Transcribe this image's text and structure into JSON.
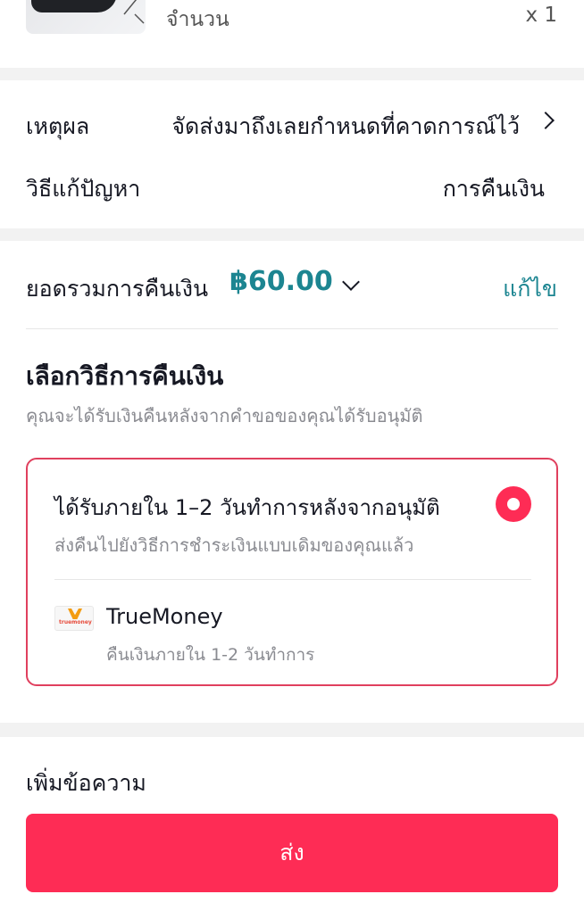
{
  "product": {
    "quantity_label": "จำนวน",
    "quantity_value": "x 1"
  },
  "reason": {
    "label": "เหตุผล",
    "value": "จัดส่งมาถึงเลยกำหนดที่คาดการณ์ไว้",
    "solution_label": "วิธีแก้ปัญหา",
    "solution_value": "การคืนเงิน"
  },
  "refund": {
    "total_label": "ยอดรวมการคืนเงิน",
    "total_amount": "฿60.00",
    "edit_label": "แก้ไข",
    "method_title": "เลือกวิธีการคืนเงิน",
    "method_subtitle": "คุณจะได้รับเงินคืนหลังจากคำขอของคุณได้รับอนุมัติ",
    "option": {
      "title": "ได้รับภายใน 1–2 วันทำการหลังจากอนุมัติ",
      "subtitle": "ส่งคืนไปยังวิธีการชำระเงินแบบเดิมของคุณแล้ว",
      "selected": true,
      "wallet_name": "TrueMoney",
      "wallet_subtitle": "คืนเงินภายใน 1-2 วันทำการ",
      "wallet_logo_text": "truemoney"
    }
  },
  "message": {
    "label": "เพิ่มข้อความ",
    "submit_label": "ส่ง"
  },
  "colors": {
    "accent": "#fe2c55",
    "teal": "#1c8591",
    "muted": "#8a8b91",
    "band": "#f2f2f2"
  }
}
